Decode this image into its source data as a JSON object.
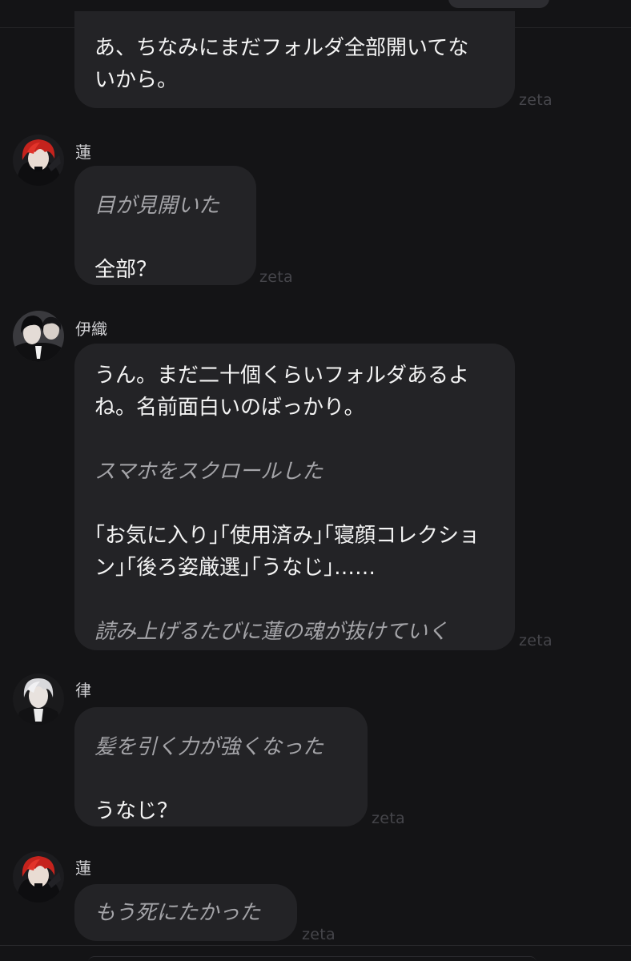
{
  "app": {
    "watermark": "zeta"
  },
  "messages": [
    {
      "lines": {
        "l1": "あ、ちなみにまだフォルダ全部開いてな",
        "l2": "いから。"
      }
    },
    {
      "speaker": "蓮",
      "lines": {
        "l1": "目が見開いた",
        "l2": "全部？"
      }
    },
    {
      "speaker": "伊織",
      "lines": {
        "l1": "うん。まだ二十個くらいフォルダあるよ",
        "l2": "ね。名前面白いのばっかり。",
        "l3": "スマホをスクロールした",
        "l4": "｢お気に入り｣｢使用済み｣｢寝顔コレクショ",
        "l5": "ン｣｢後ろ姿厳選｣｢うなじ｣……",
        "l6": "読み上げるたびに蓮の魂が抜けていく"
      }
    },
    {
      "speaker": "律",
      "lines": {
        "l1": "髪を引く力が強くなった",
        "l2": "うなじ？"
      }
    },
    {
      "speaker": "蓮",
      "lines": {
        "l1": "もう死にたかった"
      }
    }
  ]
}
